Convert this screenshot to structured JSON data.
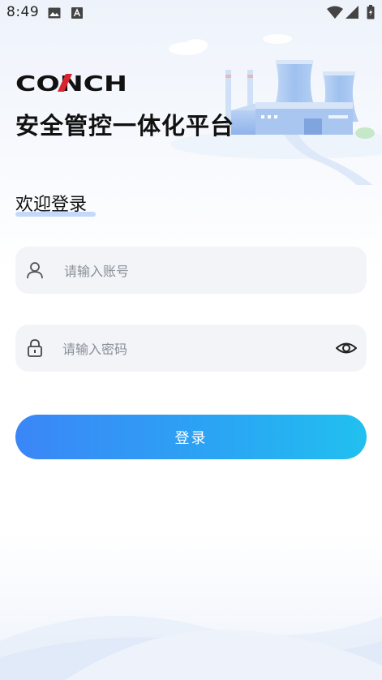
{
  "status_bar": {
    "time": "8:49",
    "icons": [
      "image-icon",
      "font-a-icon",
      "wifi-icon",
      "signal-icon",
      "battery-icon"
    ]
  },
  "header": {
    "logo_text": "CONCH",
    "platform_title": "安全管控一体化平台"
  },
  "login": {
    "welcome": "欢迎登录",
    "account_placeholder": "请输入账号",
    "password_placeholder": "请输入密码",
    "button_label": "登录"
  },
  "colors": {
    "accent_start": "#3b86f7",
    "accent_end": "#21c0f0",
    "logo_red": "#d9232e"
  }
}
